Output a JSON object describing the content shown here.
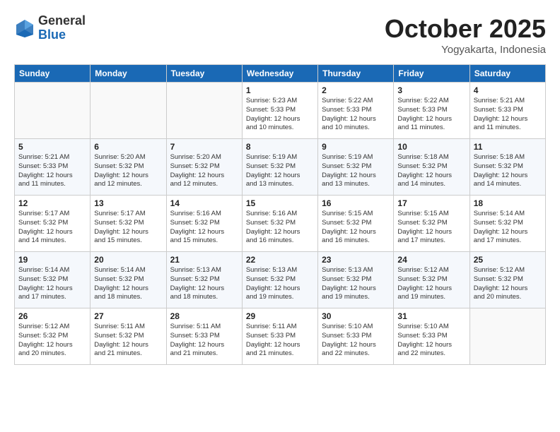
{
  "logo": {
    "general": "General",
    "blue": "Blue"
  },
  "title": "October 2025",
  "location": "Yogyakarta, Indonesia",
  "days_of_week": [
    "Sunday",
    "Monday",
    "Tuesday",
    "Wednesday",
    "Thursday",
    "Friday",
    "Saturday"
  ],
  "weeks": [
    [
      {
        "day": "",
        "info": ""
      },
      {
        "day": "",
        "info": ""
      },
      {
        "day": "",
        "info": ""
      },
      {
        "day": "1",
        "info": "Sunrise: 5:23 AM\nSunset: 5:33 PM\nDaylight: 12 hours\nand 10 minutes."
      },
      {
        "day": "2",
        "info": "Sunrise: 5:22 AM\nSunset: 5:33 PM\nDaylight: 12 hours\nand 10 minutes."
      },
      {
        "day": "3",
        "info": "Sunrise: 5:22 AM\nSunset: 5:33 PM\nDaylight: 12 hours\nand 11 minutes."
      },
      {
        "day": "4",
        "info": "Sunrise: 5:21 AM\nSunset: 5:33 PM\nDaylight: 12 hours\nand 11 minutes."
      }
    ],
    [
      {
        "day": "5",
        "info": "Sunrise: 5:21 AM\nSunset: 5:33 PM\nDaylight: 12 hours\nand 11 minutes."
      },
      {
        "day": "6",
        "info": "Sunrise: 5:20 AM\nSunset: 5:32 PM\nDaylight: 12 hours\nand 12 minutes."
      },
      {
        "day": "7",
        "info": "Sunrise: 5:20 AM\nSunset: 5:32 PM\nDaylight: 12 hours\nand 12 minutes."
      },
      {
        "day": "8",
        "info": "Sunrise: 5:19 AM\nSunset: 5:32 PM\nDaylight: 12 hours\nand 13 minutes."
      },
      {
        "day": "9",
        "info": "Sunrise: 5:19 AM\nSunset: 5:32 PM\nDaylight: 12 hours\nand 13 minutes."
      },
      {
        "day": "10",
        "info": "Sunrise: 5:18 AM\nSunset: 5:32 PM\nDaylight: 12 hours\nand 14 minutes."
      },
      {
        "day": "11",
        "info": "Sunrise: 5:18 AM\nSunset: 5:32 PM\nDaylight: 12 hours\nand 14 minutes."
      }
    ],
    [
      {
        "day": "12",
        "info": "Sunrise: 5:17 AM\nSunset: 5:32 PM\nDaylight: 12 hours\nand 14 minutes."
      },
      {
        "day": "13",
        "info": "Sunrise: 5:17 AM\nSunset: 5:32 PM\nDaylight: 12 hours\nand 15 minutes."
      },
      {
        "day": "14",
        "info": "Sunrise: 5:16 AM\nSunset: 5:32 PM\nDaylight: 12 hours\nand 15 minutes."
      },
      {
        "day": "15",
        "info": "Sunrise: 5:16 AM\nSunset: 5:32 PM\nDaylight: 12 hours\nand 16 minutes."
      },
      {
        "day": "16",
        "info": "Sunrise: 5:15 AM\nSunset: 5:32 PM\nDaylight: 12 hours\nand 16 minutes."
      },
      {
        "day": "17",
        "info": "Sunrise: 5:15 AM\nSunset: 5:32 PM\nDaylight: 12 hours\nand 17 minutes."
      },
      {
        "day": "18",
        "info": "Sunrise: 5:14 AM\nSunset: 5:32 PM\nDaylight: 12 hours\nand 17 minutes."
      }
    ],
    [
      {
        "day": "19",
        "info": "Sunrise: 5:14 AM\nSunset: 5:32 PM\nDaylight: 12 hours\nand 17 minutes."
      },
      {
        "day": "20",
        "info": "Sunrise: 5:14 AM\nSunset: 5:32 PM\nDaylight: 12 hours\nand 18 minutes."
      },
      {
        "day": "21",
        "info": "Sunrise: 5:13 AM\nSunset: 5:32 PM\nDaylight: 12 hours\nand 18 minutes."
      },
      {
        "day": "22",
        "info": "Sunrise: 5:13 AM\nSunset: 5:32 PM\nDaylight: 12 hours\nand 19 minutes."
      },
      {
        "day": "23",
        "info": "Sunrise: 5:13 AM\nSunset: 5:32 PM\nDaylight: 12 hours\nand 19 minutes."
      },
      {
        "day": "24",
        "info": "Sunrise: 5:12 AM\nSunset: 5:32 PM\nDaylight: 12 hours\nand 19 minutes."
      },
      {
        "day": "25",
        "info": "Sunrise: 5:12 AM\nSunset: 5:32 PM\nDaylight: 12 hours\nand 20 minutes."
      }
    ],
    [
      {
        "day": "26",
        "info": "Sunrise: 5:12 AM\nSunset: 5:32 PM\nDaylight: 12 hours\nand 20 minutes."
      },
      {
        "day": "27",
        "info": "Sunrise: 5:11 AM\nSunset: 5:32 PM\nDaylight: 12 hours\nand 21 minutes."
      },
      {
        "day": "28",
        "info": "Sunrise: 5:11 AM\nSunset: 5:33 PM\nDaylight: 12 hours\nand 21 minutes."
      },
      {
        "day": "29",
        "info": "Sunrise: 5:11 AM\nSunset: 5:33 PM\nDaylight: 12 hours\nand 21 minutes."
      },
      {
        "day": "30",
        "info": "Sunrise: 5:10 AM\nSunset: 5:33 PM\nDaylight: 12 hours\nand 22 minutes."
      },
      {
        "day": "31",
        "info": "Sunrise: 5:10 AM\nSunset: 5:33 PM\nDaylight: 12 hours\nand 22 minutes."
      },
      {
        "day": "",
        "info": ""
      }
    ]
  ]
}
